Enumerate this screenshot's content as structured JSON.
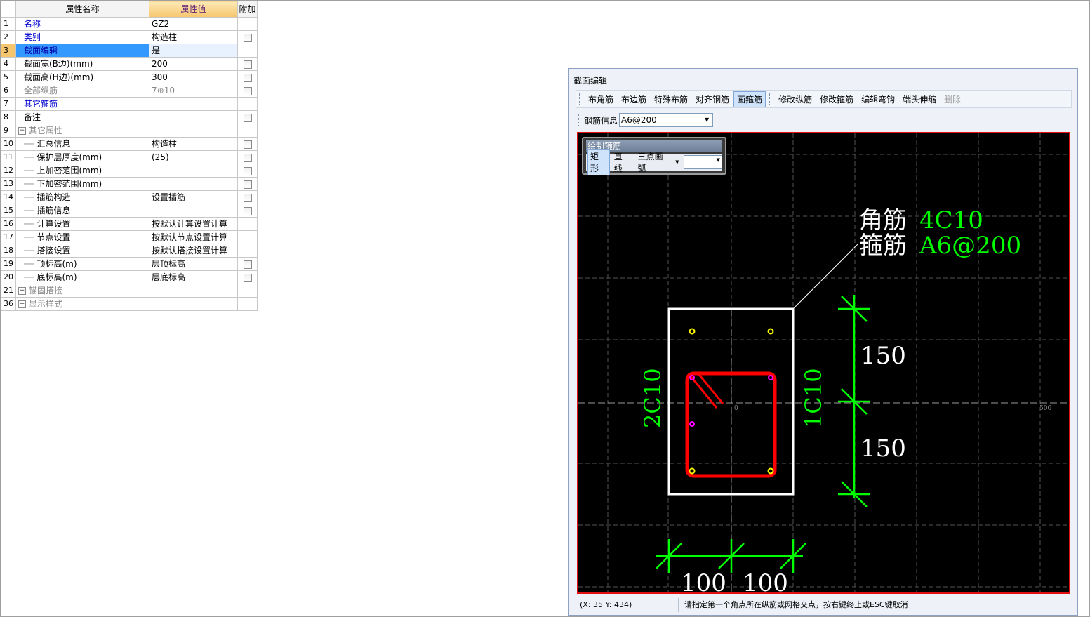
{
  "grid": {
    "headers": {
      "name": "属性名称",
      "value": "属性值",
      "extra": "附加"
    },
    "rows": [
      {
        "num": "1",
        "name": "名称",
        "value": "GZ2"
      },
      {
        "num": "2",
        "name": "类别",
        "value": "构造柱"
      },
      {
        "num": "3",
        "name": "截面编辑",
        "value": "是"
      },
      {
        "num": "4",
        "name": "截面宽(B边)(mm)",
        "value": "200"
      },
      {
        "num": "5",
        "name": "截面高(H边)(mm)",
        "value": "300"
      },
      {
        "num": "6",
        "name": "全部纵筋",
        "value": "7⊕10"
      },
      {
        "num": "7",
        "name": "其它箍筋",
        "value": ""
      },
      {
        "num": "8",
        "name": "备注",
        "value": ""
      },
      {
        "num": "9",
        "name": "其它属性",
        "value": ""
      },
      {
        "num": "10",
        "name": "汇总信息",
        "value": "构造柱"
      },
      {
        "num": "11",
        "name": "保护层厚度(mm)",
        "value": "(25)"
      },
      {
        "num": "12",
        "name": "上加密范围(mm)",
        "value": ""
      },
      {
        "num": "13",
        "name": "下加密范围(mm)",
        "value": ""
      },
      {
        "num": "14",
        "name": "插筋构造",
        "value": "设置插筋"
      },
      {
        "num": "15",
        "name": "插筋信息",
        "value": ""
      },
      {
        "num": "16",
        "name": "计算设置",
        "value": "按默认计算设置计算"
      },
      {
        "num": "17",
        "name": "节点设置",
        "value": "按默认节点设置计算"
      },
      {
        "num": "18",
        "name": "搭接设置",
        "value": "按默认搭接设置计算"
      },
      {
        "num": "19",
        "name": "顶标高(m)",
        "value": "层顶标高"
      },
      {
        "num": "20",
        "name": "底标高(m)",
        "value": "层底标高"
      },
      {
        "num": "21",
        "name": "锚固搭接",
        "value": ""
      },
      {
        "num": "36",
        "name": "显示样式",
        "value": ""
      }
    ]
  },
  "dialog": {
    "title": "截面编辑",
    "toolbar": {
      "buttons": [
        "布角筋",
        "布边筋",
        "特殊布筋",
        "对齐钢筋",
        "画箍筋",
        "修改纵筋",
        "修改箍筋",
        "编辑弯钩",
        "端头伸缩",
        "删除"
      ],
      "rebar_info_label": "钢筋信息",
      "rebar_info_value": "A6@200"
    },
    "draw_panel": {
      "title": "绘制箍筋",
      "buttons": [
        "矩形",
        "直线",
        "三点画弧"
      ]
    },
    "canvas": {
      "corner_label": "角筋",
      "corner_value": "4C10",
      "stirrup_label": "箍筋",
      "stirrup_value": "A6@200",
      "left_side": "2C10",
      "right_side": "1C10",
      "dim_top": "150",
      "dim_bottom": "150",
      "dim_left": "100",
      "dim_right": "100",
      "axis_origin": "0",
      "axis_end": "500"
    },
    "status": {
      "coord": "(X: 35 Y: 434)",
      "message": "请指定第一个角点所在纵筋或网格交点，按右键终止或ESC键取消"
    }
  },
  "colors": {
    "canvas_bg": "#000000",
    "stirrup": "#ff0000",
    "dimension": "#00ff00",
    "section_outline": "#ffffff",
    "rebar_label": "#00ff00"
  }
}
